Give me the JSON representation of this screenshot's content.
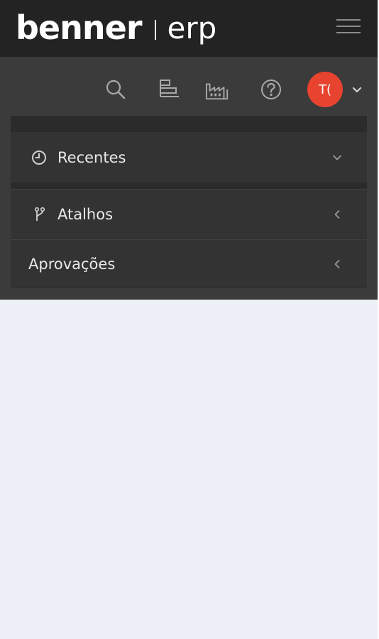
{
  "header": {
    "brand_name": "benner",
    "brand_product": "erp",
    "menu_icon": "hamburger-icon"
  },
  "toolbar": {
    "icons": [
      "search-icon",
      "hierarchy-icon",
      "factory-icon",
      "help-icon"
    ],
    "avatar_initials": "T(",
    "avatar_color": "#e8432f",
    "caret_icon": "chevron-down-icon"
  },
  "menu": {
    "items": [
      {
        "label": "Recentes",
        "icon": "clock-icon",
        "chevron": "chevron-down-icon"
      },
      {
        "label": "Atalhos",
        "icon": "branch-icon",
        "chevron": "chevron-left-icon"
      },
      {
        "label": "Aprovações",
        "chevron": "chevron-left-icon"
      }
    ]
  },
  "colors": {
    "topbar": "#232323",
    "sidebar": "#3b3b3b",
    "panel": "#2b2b2b",
    "content_bg": "#edf0f6"
  }
}
